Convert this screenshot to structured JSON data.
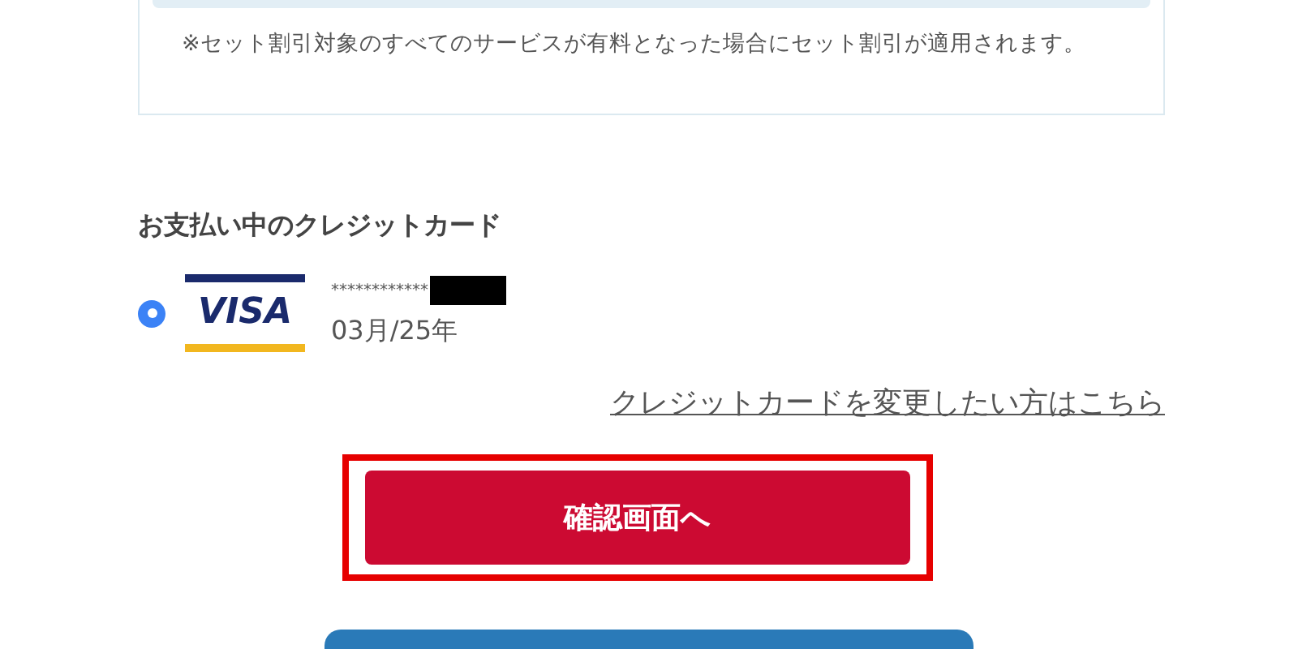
{
  "notice": "※セット割引対象のすべてのサービスが有料となった場合にセット割引が適用されます。",
  "section_title": "お支払い中のクレジットカード",
  "cards": [
    {
      "brand_label": "VISA",
      "number": "************",
      "expiry": "03月/25年",
      "selected": true
    }
  ],
  "change_card_link": "クレジットカードを変更したい方はこちら",
  "confirm_button": {
    "label": "確認画面へ",
    "highlighted": true
  }
}
